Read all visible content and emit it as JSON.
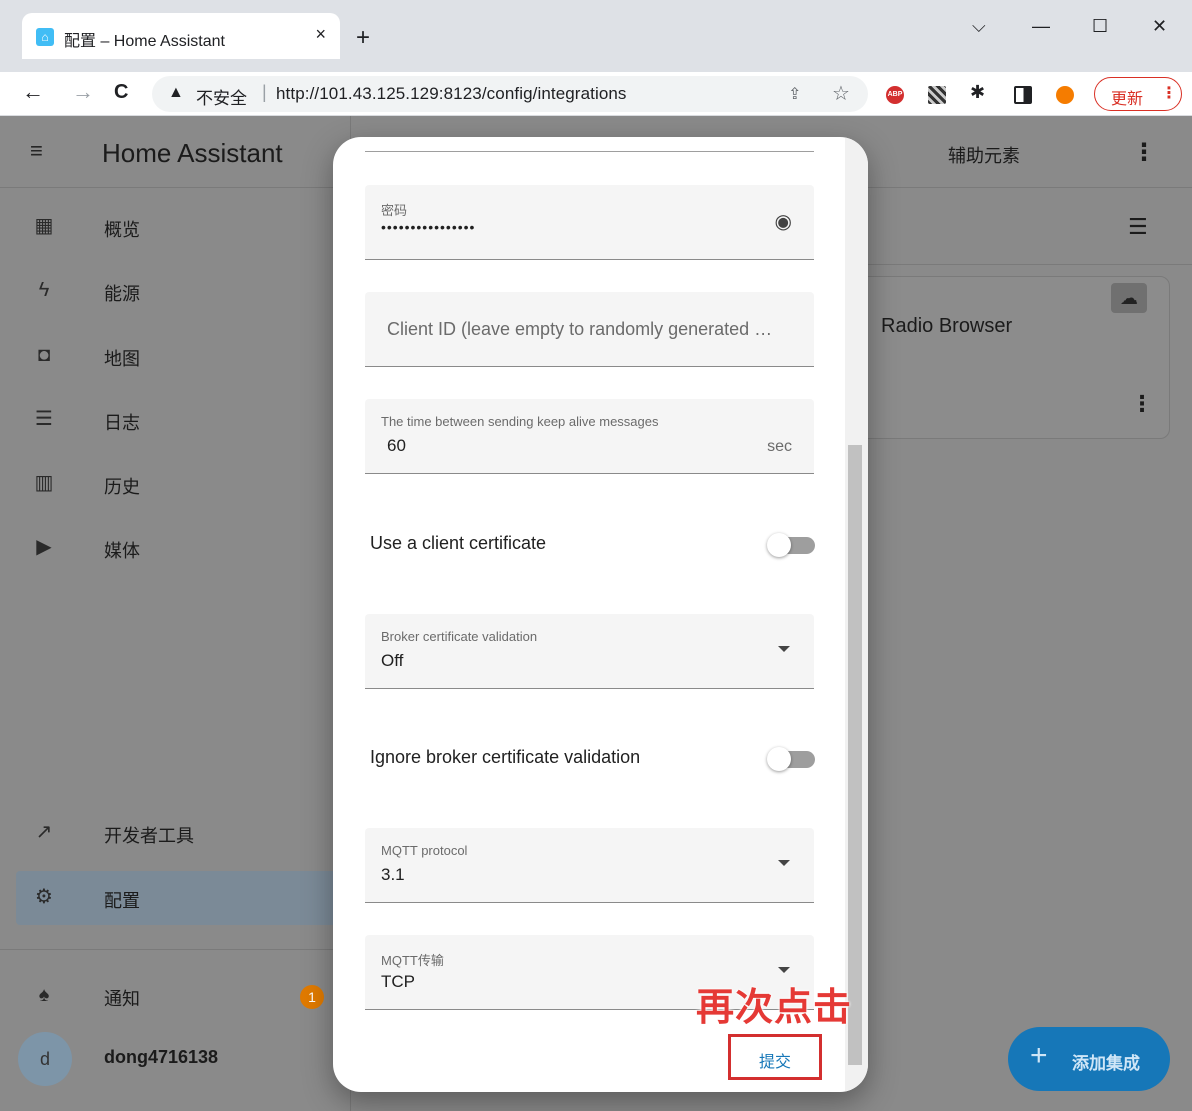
{
  "browser": {
    "tab_title": "配置 – Home Assistant",
    "tab_close": "×",
    "new_tab": "+",
    "window_controls": {
      "chevron": "⌵",
      "minimize": "—",
      "maximize": "☐",
      "close": "✕"
    },
    "nav": {
      "back": "←",
      "forward": "→",
      "reload": "C"
    },
    "insecure_label": "不安全",
    "url": "http://101.43.125.129:8123/config/integrations",
    "update_label": "更新",
    "update_more": "⋮",
    "extension_icons": [
      "abp-icon",
      "qr-icon",
      "puzzle-icon",
      "sidepanel-icon",
      "profile-icon"
    ],
    "colors": {
      "frame": "#dee1e6",
      "warning": "#d93025"
    }
  },
  "sidebar": {
    "title": "Home Assistant",
    "items": [
      {
        "label": "概览",
        "icon": "dashboard-icon"
      },
      {
        "label": "能源",
        "icon": "lightning-icon"
      },
      {
        "label": "地图",
        "icon": "map-person-icon"
      },
      {
        "label": "日志",
        "icon": "logbook-icon"
      },
      {
        "label": "历史",
        "icon": "chart-icon"
      },
      {
        "label": "媒体",
        "icon": "media-icon"
      }
    ],
    "dev_tools": "开发者工具",
    "config": "配置",
    "notifications": "通知",
    "notification_count": "1",
    "user_initial": "d",
    "user_name": "dong4716138"
  },
  "main": {
    "tab_helpers": "辅助元素",
    "card_name": "Radio Browser",
    "add_integration": "添加集成",
    "colors": {
      "fab": "#1677b8"
    }
  },
  "dialog": {
    "password": {
      "label": "密码",
      "value": "••••••••••••••••"
    },
    "client_id": {
      "placeholder": "Client ID (leave empty to randomly generated …"
    },
    "keepalive": {
      "label": "The time between sending keep alive messages",
      "value": "60",
      "suffix": "sec"
    },
    "client_cert": {
      "label": "Use a client certificate",
      "on": false
    },
    "broker_validation": {
      "label": "Broker certificate validation",
      "value": "Off"
    },
    "ignore_validation": {
      "label": "Ignore broker certificate validation",
      "on": false
    },
    "protocol": {
      "label": "MQTT protocol",
      "value": "3.1"
    },
    "transport": {
      "label": "MQTT传输",
      "value": "TCP"
    },
    "submit": "提交"
  },
  "annotation": "再次点击"
}
